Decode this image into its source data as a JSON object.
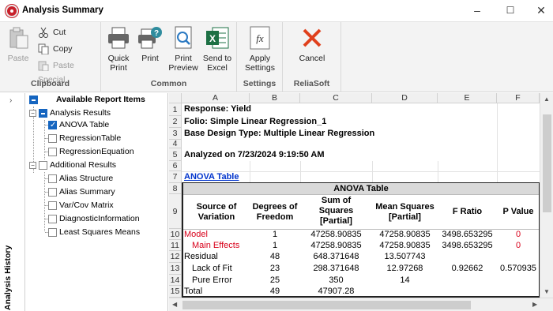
{
  "window": {
    "title": "Analysis Summary"
  },
  "ribbon": {
    "clipboard": {
      "label": "Clipboard",
      "paste": "Paste",
      "cut": "Cut",
      "copy": "Copy",
      "paste_special": "Paste Special"
    },
    "common": {
      "label": "Common",
      "quick_print": "Quick\nPrint",
      "print": "Print",
      "print_preview": "Print\nPreview",
      "send_to_excel": "Send to\nExcel"
    },
    "settings": {
      "label": "Settings",
      "apply_settings": "Apply\nSettings"
    },
    "reliasoft": {
      "label": "ReliaSoft",
      "cancel": "Cancel"
    }
  },
  "side_panel": {
    "label": "Analysis History"
  },
  "tree": {
    "root": "Available Report Items",
    "items": [
      {
        "label": "Analysis Results"
      },
      {
        "label": "ANOVA Table"
      },
      {
        "label": "RegressionTable"
      },
      {
        "label": "RegressionEquation"
      },
      {
        "label": "Additional Results"
      },
      {
        "label": "Alias Structure"
      },
      {
        "label": "Alias Summary"
      },
      {
        "label": "Var/Cov Matrix"
      },
      {
        "label": "DiagnosticInformation"
      },
      {
        "label": "Least Squares Means"
      }
    ]
  },
  "sheet": {
    "columns": [
      "A",
      "B",
      "C",
      "D",
      "E",
      "F"
    ],
    "rows": [
      "1",
      "2",
      "3",
      "4",
      "5",
      "6",
      "7",
      "8",
      "9",
      "10",
      "11",
      "12",
      "13",
      "14",
      "15"
    ],
    "response": "Response: Yield",
    "folio": "Folio: Simple Linear Regression_1",
    "base_design": "Base Design Type: Multiple Linear Regression",
    "analyzed": "Analyzed on 7/23/2024 9:19:50 AM",
    "anova_link": "ANOVA Table",
    "anova_title": "ANOVA Table",
    "headers": [
      "Source of\nVariation",
      "Degrees of\nFreedom",
      "Sum of\nSquares\n[Partial]",
      "Mean Squares\n[Partial]",
      "F Ratio",
      "P Value"
    ],
    "data": [
      [
        "Model",
        "1",
        "47258.90835",
        "47258.90835",
        "3498.653295",
        "0"
      ],
      [
        "Main Effects",
        "1",
        "47258.90835",
        "47258.90835",
        "3498.653295",
        "0"
      ],
      [
        "Residual",
        "48",
        "648.371648",
        "13.507743",
        "",
        ""
      ],
      [
        "Lack of Fit",
        "23",
        "298.371648",
        "12.97268",
        "0.92662",
        "0.570935"
      ],
      [
        "Pure Error",
        "25",
        "350",
        "14",
        "",
        ""
      ],
      [
        "Total",
        "49",
        "47907.28",
        "",
        "",
        ""
      ]
    ]
  }
}
